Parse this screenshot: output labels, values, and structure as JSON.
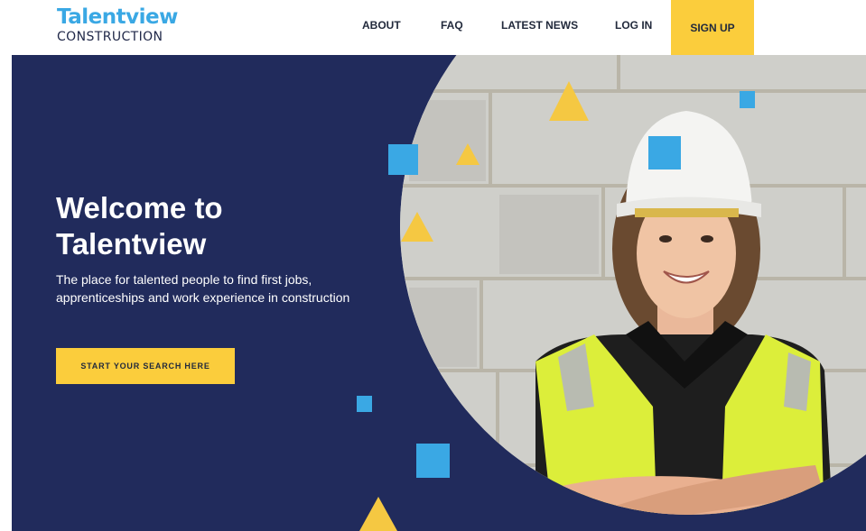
{
  "brand": {
    "name": "Talentview",
    "subtitle": "CONSTRUCTION",
    "primary_color": "#3aa8e4",
    "dark_color": "#212b5c"
  },
  "nav": {
    "items": [
      {
        "label": "ABOUT"
      },
      {
        "label": "FAQ"
      },
      {
        "label": "LATEST NEWS"
      },
      {
        "label": "LOG IN"
      }
    ],
    "signup": "SIGN UP",
    "accent_color": "#fbcd3c"
  },
  "hero": {
    "title": "Welcome to Talentview",
    "subtitle": "The place for talented people to find first jobs, apprenticeships and work experience in construction",
    "cta": "START YOUR SEARCH HERE",
    "image": "construction-worker-photo"
  }
}
